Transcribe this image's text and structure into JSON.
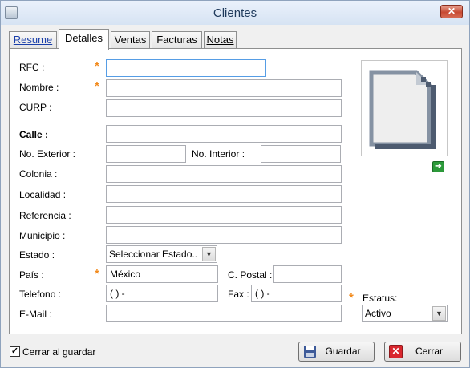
{
  "window": {
    "title": "Clientes",
    "close_glyph": "✕"
  },
  "tabs": [
    {
      "label": "Resume"
    },
    {
      "label": "Detalles"
    },
    {
      "label": "Ventas"
    },
    {
      "label": "Facturas"
    },
    {
      "label": "Notas"
    }
  ],
  "form": {
    "rfc": {
      "label": "RFC :",
      "value": ""
    },
    "nombre": {
      "label": "Nombre :",
      "value": ""
    },
    "curp": {
      "label": "CURP :",
      "value": ""
    },
    "calle": {
      "label": "Calle :",
      "value": ""
    },
    "no_exterior": {
      "label": "No. Exterior :",
      "value": ""
    },
    "no_interior": {
      "label": "No. Interior :",
      "value": ""
    },
    "colonia": {
      "label": "Colonia :",
      "value": ""
    },
    "localidad": {
      "label": "Localidad :",
      "value": ""
    },
    "referencia": {
      "label": "Referencia :",
      "value": ""
    },
    "municipio": {
      "label": "Municipio :",
      "value": ""
    },
    "estado": {
      "label": "Estado :",
      "value": "Seleccionar Estado.."
    },
    "pais": {
      "label": "País :",
      "value": "México"
    },
    "c_postal": {
      "label": "C. Postal :",
      "value": ""
    },
    "telefono": {
      "label": "Telefono :",
      "value": "(   )    -"
    },
    "fax": {
      "label": "Fax :",
      "value": "(   )    -"
    },
    "email": {
      "label": "E-Mail :",
      "value": ""
    },
    "estatus": {
      "label": "Estatus:",
      "value": "Activo"
    }
  },
  "required_marker": "*",
  "photo": {
    "icon": "blank-document-icon",
    "action_icon": "arrow-right-icon",
    "action_glyph": "➔"
  },
  "footer": {
    "close_on_save": {
      "label": "Cerrar al guardar",
      "checked": true,
      "check_glyph": "✓"
    },
    "save_label": "Guardar",
    "cancel_label": "Cerrar",
    "cancel_glyph": "✕"
  },
  "colors": {
    "required": "#f28b1e",
    "accent_link": "#1a3faa",
    "focus_border": "#569de5"
  }
}
